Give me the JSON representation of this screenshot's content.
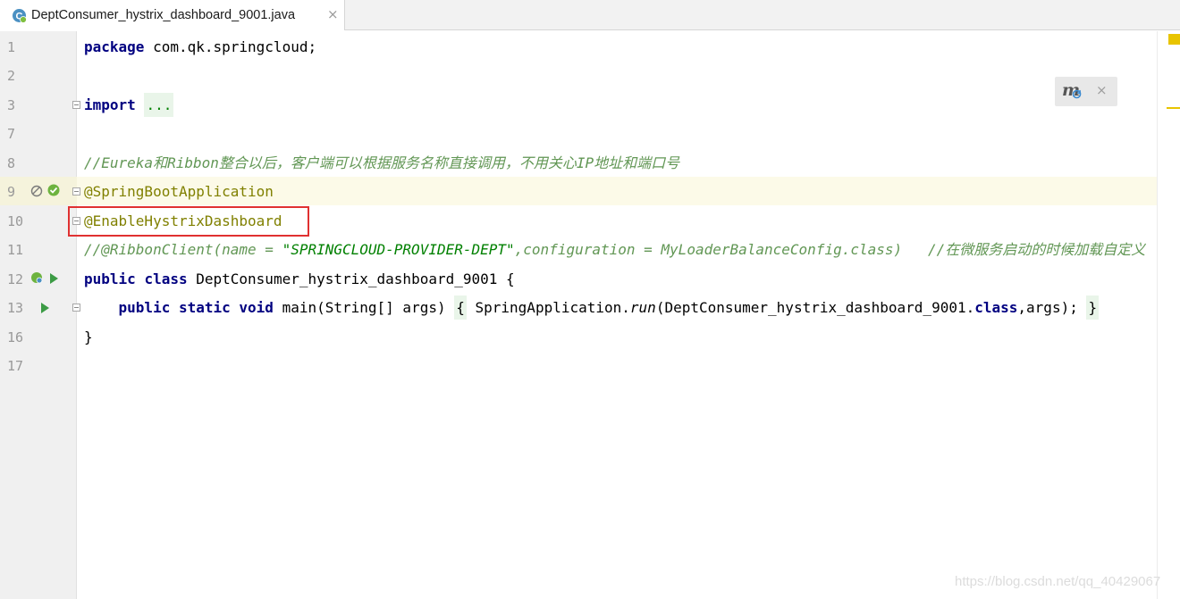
{
  "tab": {
    "title": "DeptConsumer_hystrix_dashboard_9001.java",
    "close": "×",
    "icon": "java-class-icon"
  },
  "line_numbers": [
    "1",
    "2",
    "3",
    "7",
    "8",
    "9",
    "10",
    "11",
    "12",
    "13",
    "16",
    "17"
  ],
  "code": {
    "l1_kw": "package",
    "l1_rest": " com.qk.springcloud;",
    "l3_kw": "import",
    "l3_fold": "...",
    "l8_comment": "//Eureka和Ribbon整合以后，客户端可以根据服务名称直接调用，不用关心IP地址和端口号",
    "l9_ann": "@SpringBootApplication",
    "l10_ann": "@EnableHystrixDashboard",
    "l11_a": "//@RibbonClient(name = ",
    "l11_str": "\"SPRINGCLOUD-PROVIDER-DEPT\"",
    "l11_b": ",configuration = MyLoaderBalanceConfig.class)   ",
    "l11_c": "//在微服务启动的时候加载自定义",
    "l12_kw1": "public",
    "l12_kw2": "class",
    "l12_rest": " DeptConsumer_hystrix_dashboard_9001 {",
    "l13_kw1": "public",
    "l13_kw2": "static",
    "l13_kw3": "void",
    "l13_a": " main(String[] args) ",
    "l13_lb": "{",
    "l13_b": " SpringApplication.",
    "l13_run": "run",
    "l13_c": "(DeptConsumer_hystrix_dashboard_9001.",
    "l13_kw4": "class",
    "l13_d": ",args); ",
    "l13_rb": "}",
    "l16": "}"
  },
  "popup": {
    "icon": "maven-reload-icon",
    "label": "m",
    "close": "×"
  },
  "watermark": "https://blog.csdn.net/qq_40429067",
  "colors": {
    "keyword": "#000080",
    "annotation": "#808000",
    "comment": "#629755",
    "string": "#008000",
    "highlight": "#fcfae8",
    "redbox": "#e03131"
  }
}
